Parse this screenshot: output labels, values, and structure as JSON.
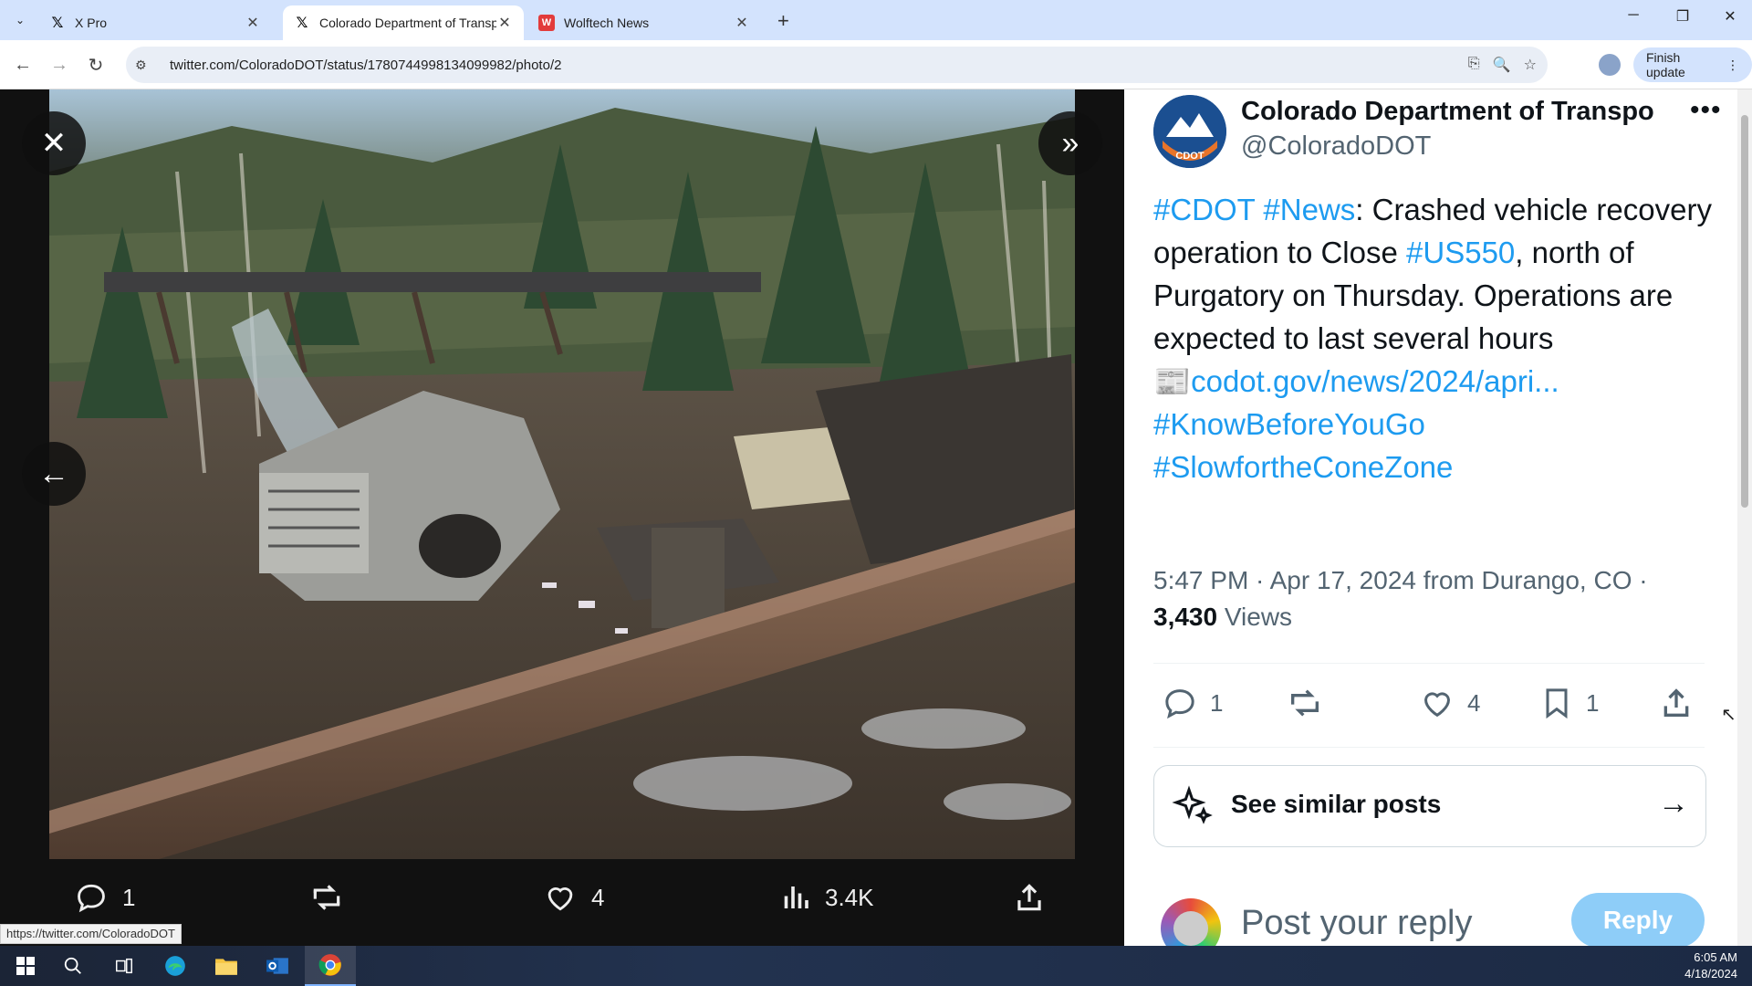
{
  "browser": {
    "tabs": [
      {
        "label": "X Pro",
        "favicon": "x-icon"
      },
      {
        "label": "Colorado Department of Transp",
        "favicon": "x-icon"
      },
      {
        "label": "Wolftech News",
        "favicon": "wolftech-icon"
      }
    ],
    "url": "twitter.com/ColoradoDOT/status/1780744998134099982/photo/2",
    "finish_update": "Finish update",
    "status_url": "https://twitter.com/ColoradoDOT"
  },
  "media_viewer": {
    "reply_count": "1",
    "like_count": "4",
    "view_count": "3.4K"
  },
  "tweet": {
    "author_name": "Colorado Department of Transpo",
    "author_handle": "@ColoradoDOT",
    "avatar_label": "CDOT",
    "text": {
      "tag1": "#CDOT",
      "tag2": "#News",
      "part1": ": Crashed vehicle recovery operation to Close ",
      "tag3": "#US550",
      "part2": ", north of Purgatory on Thursday. Operations are expected to last several hours",
      "link_emoji": "📰",
      "link": "codot.gov/news/2024/apri...",
      "tag4": "#KnowBeforeYouGo",
      "tag5": "#SlowfortheConeZone"
    },
    "timestamp": "5:47 PM · Apr 17, 2024 from Durango, CO · ",
    "views_count": "3,430",
    "views_label": " Views",
    "actions": {
      "reply_count": "1",
      "like_count": "4",
      "bookmark_count": "1"
    },
    "see_similar": "See similar posts",
    "reply_placeholder": "Post your reply",
    "reply_button": "Reply"
  },
  "taskbar": {
    "time": "6:05 AM",
    "date": "4/18/2024"
  },
  "colors": {
    "link_blue": "#1d9bf0",
    "tab_bar": "#d3e3fd"
  }
}
